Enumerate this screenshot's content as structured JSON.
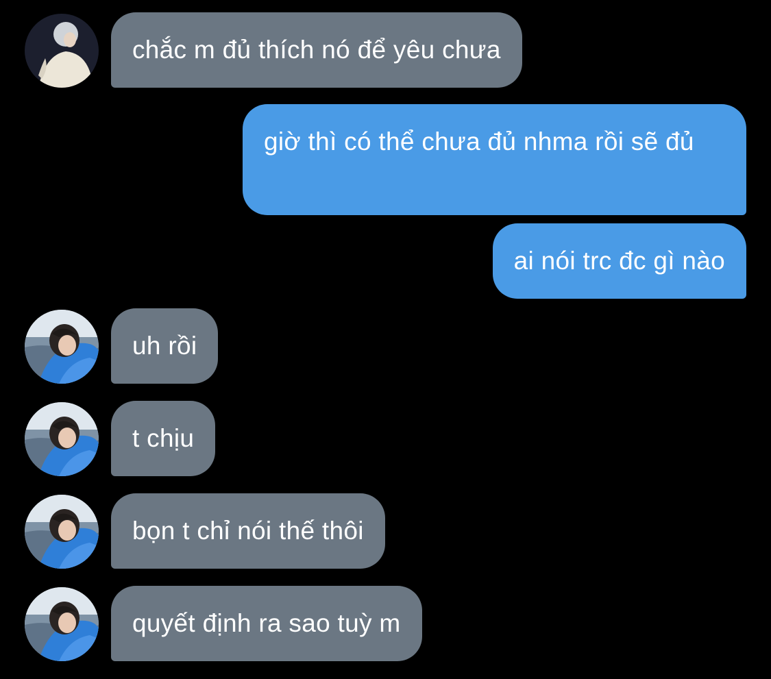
{
  "colors": {
    "background": "#000000",
    "incoming_bubble": "#6b7783",
    "outgoing_bubble": "#4a9be6",
    "text": "#ffffff"
  },
  "messages": [
    {
      "direction": "incoming",
      "avatar": "avatar-white-hair",
      "text": "chắc m đủ thích nó để yêu chưa"
    },
    {
      "direction": "outgoing",
      "text": "giờ thì có thể chưa đủ nhma rồi sẽ đủ"
    },
    {
      "direction": "outgoing",
      "text": "ai nói trc đc gì nào"
    },
    {
      "direction": "incoming",
      "avatar": "avatar-blue-shirt",
      "text": "uh rồi"
    },
    {
      "direction": "incoming",
      "avatar": "avatar-blue-shirt",
      "text": "t chịu"
    },
    {
      "direction": "incoming",
      "avatar": "avatar-blue-shirt",
      "text": "bọn t chỉ nói thế thôi"
    },
    {
      "direction": "incoming",
      "avatar": "avatar-blue-shirt",
      "text": "quyết định ra sao tuỳ m"
    }
  ]
}
